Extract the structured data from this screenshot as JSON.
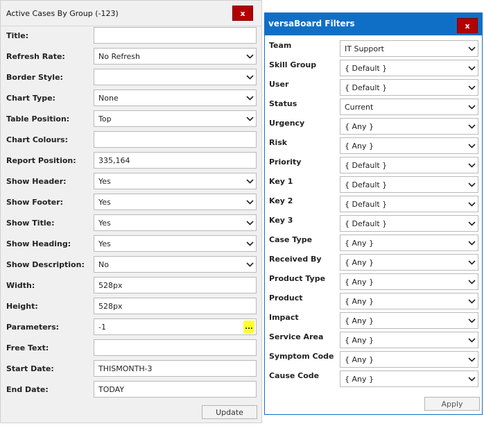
{
  "left_panel": {
    "title": "Active Cases By Group (-123)",
    "close_label": "x",
    "fields": [
      {
        "label": "Title:",
        "value": "",
        "type": "text"
      },
      {
        "label": "Refresh Rate:",
        "value": "No Refresh",
        "type": "select"
      },
      {
        "label": "Border Style:",
        "value": "",
        "type": "select"
      },
      {
        "label": "Chart Type:",
        "value": "None",
        "type": "select"
      },
      {
        "label": "Table Position:",
        "value": "Top",
        "type": "select"
      },
      {
        "label": "Chart Colours:",
        "value": "",
        "type": "text"
      },
      {
        "label": "Report Position:",
        "value": "335,164",
        "type": "text"
      },
      {
        "label": "Show Header:",
        "value": "Yes",
        "type": "select"
      },
      {
        "label": "Show Footer:",
        "value": "Yes",
        "type": "select"
      },
      {
        "label": "Show Title:",
        "value": "Yes",
        "type": "select"
      },
      {
        "label": "Show Heading:",
        "value": "Yes",
        "type": "select"
      },
      {
        "label": "Show Description:",
        "value": "No",
        "type": "select"
      },
      {
        "label": "Width:",
        "value": "528px",
        "type": "text"
      },
      {
        "label": "Height:",
        "value": "528px",
        "type": "text"
      },
      {
        "label": "Parameters:",
        "value": "-1",
        "type": "text-button"
      },
      {
        "label": "Free Text:",
        "value": "",
        "type": "text"
      },
      {
        "label": "Start Date:",
        "value": "THISMONTH-3",
        "type": "text"
      },
      {
        "label": "End Date:",
        "value": "TODAY",
        "type": "text"
      }
    ],
    "dots_label": "...",
    "update_label": "Update"
  },
  "right_panel": {
    "title": "versaBoard Filters",
    "close_label": "x",
    "filters": [
      {
        "label": "Team",
        "value": "IT Support"
      },
      {
        "label": "Skill Group",
        "value": "{ Default }"
      },
      {
        "label": "User",
        "value": "{ Default }"
      },
      {
        "label": "Status",
        "value": "Current"
      },
      {
        "label": "Urgency",
        "value": "{ Any }"
      },
      {
        "label": "Risk",
        "value": "{ Any }"
      },
      {
        "label": "Priority",
        "value": "{ Default }"
      },
      {
        "label": "Key 1",
        "value": "{ Default }"
      },
      {
        "label": "Key 2",
        "value": "{ Default }"
      },
      {
        "label": "Key 3",
        "value": "{ Default }"
      },
      {
        "label": "Case Type",
        "value": "{ Any }"
      },
      {
        "label": "Received By",
        "value": "{ Any }"
      },
      {
        "label": "Product Type",
        "value": "{ Any }"
      },
      {
        "label": "Product",
        "value": "{ Any }"
      },
      {
        "label": "Impact",
        "value": "{ Any }"
      },
      {
        "label": "Service Area",
        "value": "{ Any }"
      },
      {
        "label": "Symptom Code",
        "value": "{ Any }"
      },
      {
        "label": "Cause Code",
        "value": "{ Any }"
      }
    ],
    "apply_label": "Apply"
  },
  "colors": {
    "accent_blue": "#0f6fc6",
    "close_red": "#b30000",
    "highlight_yellow": "#ffff33"
  },
  "icons": {
    "dropdown": "chevron-down-icon",
    "close": "close-icon",
    "more": "ellipsis-icon"
  }
}
